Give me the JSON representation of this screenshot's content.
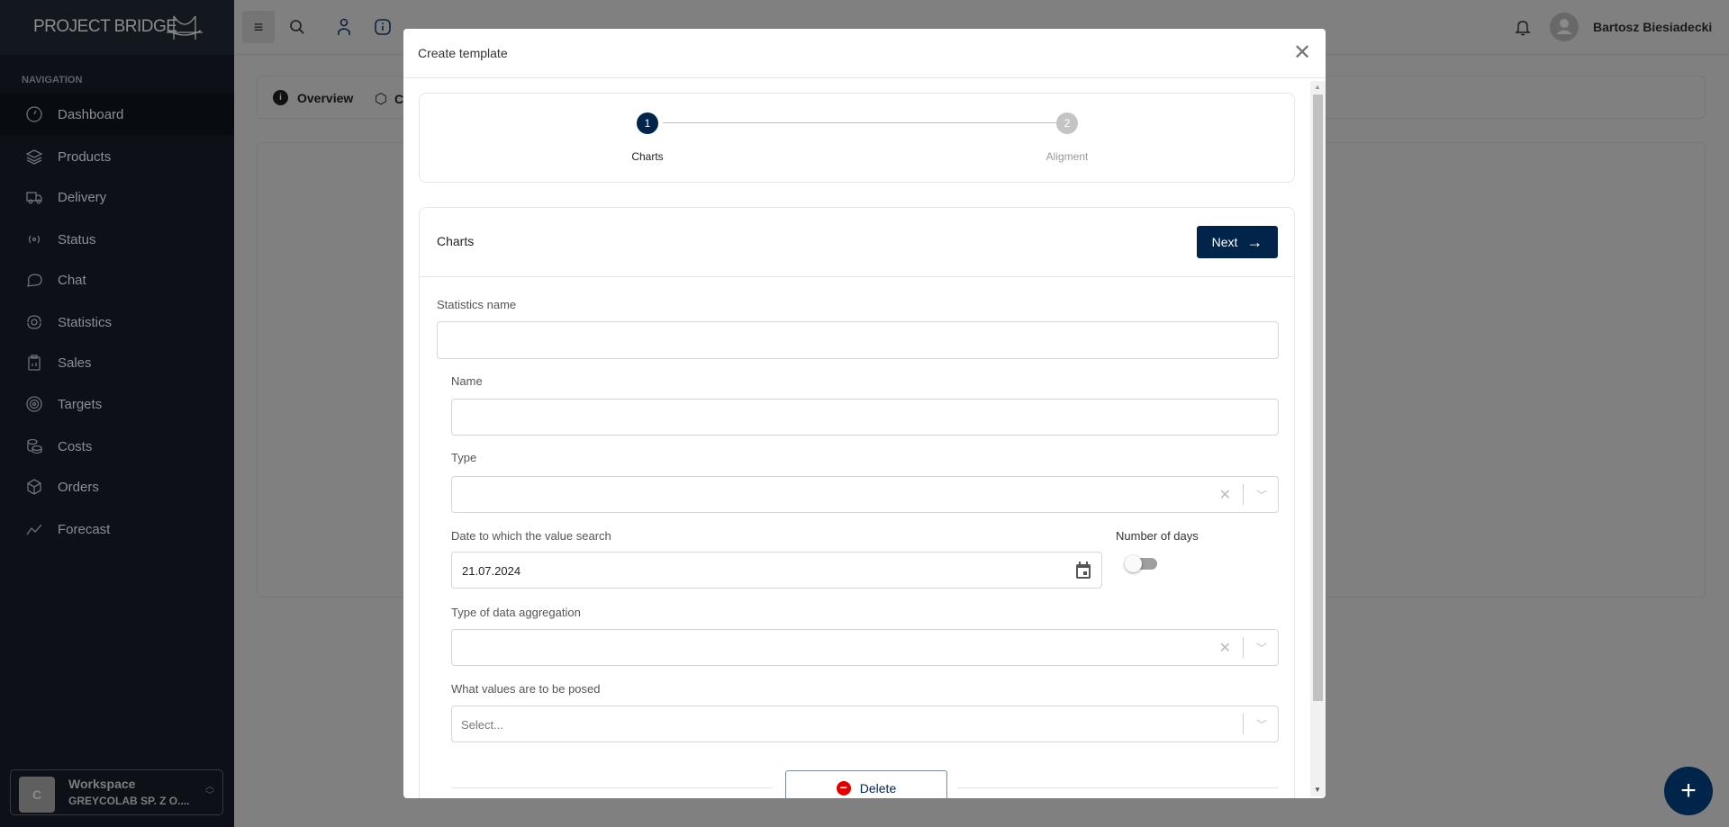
{
  "app": {
    "logo": "PROJECT BRIDGE",
    "nav_heading": "NAVIGATION",
    "nav": [
      {
        "label": "Dashboard",
        "icon": "gauge-icon"
      },
      {
        "label": "Products",
        "icon": "layers-icon"
      },
      {
        "label": "Delivery",
        "icon": "truck-icon"
      },
      {
        "label": "Status",
        "icon": "broadcast-icon"
      },
      {
        "label": "Chat",
        "icon": "chat-icon"
      },
      {
        "label": "Statistics",
        "icon": "eye-cycle-icon"
      },
      {
        "label": "Sales",
        "icon": "clipboard-icon"
      },
      {
        "label": "Targets",
        "icon": "target-icon"
      },
      {
        "label": "Costs",
        "icon": "coins-icon"
      },
      {
        "label": "Orders",
        "icon": "box-icon"
      },
      {
        "label": "Forecast",
        "icon": "trend-icon"
      }
    ],
    "active_nav": "Dashboard",
    "workspace": {
      "avatar": "C",
      "title": "Workspace",
      "company": "GREYCOLAB SP. Z O...."
    },
    "user": "Bartosz Biesiadecki",
    "tabs": [
      {
        "label": "Overview"
      },
      {
        "label": "C"
      }
    ]
  },
  "modal": {
    "title": "Create template",
    "steps": [
      {
        "num": "1",
        "label": "Charts",
        "active": true
      },
      {
        "num": "2",
        "label": "Aligment",
        "active": false
      }
    ],
    "section_title": "Charts",
    "next_label": "Next",
    "fields": {
      "statistics_name": {
        "label": "Statistics name",
        "value": ""
      },
      "name": {
        "label": "Name",
        "value": ""
      },
      "type": {
        "label": "Type",
        "value": ""
      },
      "date": {
        "label": "Date to which the value search",
        "value": "21.07.2024"
      },
      "number_of_days": {
        "label": "Number of days",
        "on": false
      },
      "aggregation": {
        "label": "Type of data aggregation",
        "value": ""
      },
      "values": {
        "label": "What values are to be posed",
        "placeholder": "Select..."
      }
    },
    "delete_label": "Delete"
  },
  "colors": {
    "primary": "#01244a",
    "danger": "#e00000"
  }
}
